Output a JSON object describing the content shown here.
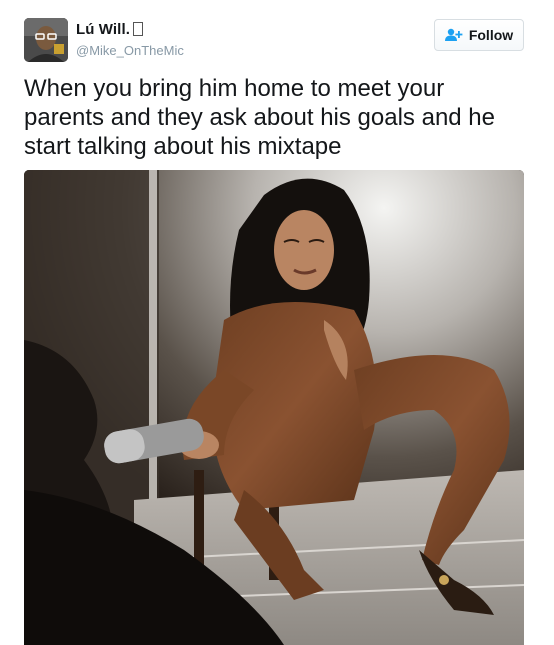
{
  "user": {
    "display_name": "Lú Will.",
    "handle": "@Mike_OnTheMic"
  },
  "follow_button": {
    "label": "Follow",
    "icon": "add-user-icon"
  },
  "tweet": {
    "text": "When you bring him home to meet your parents and they ask about his goals and he start talking about his mixtape"
  },
  "colors": {
    "text": "#14171a",
    "handle": "#8899a6",
    "button_border": "#d8dee2",
    "follow_icon": "#1da1f2"
  }
}
